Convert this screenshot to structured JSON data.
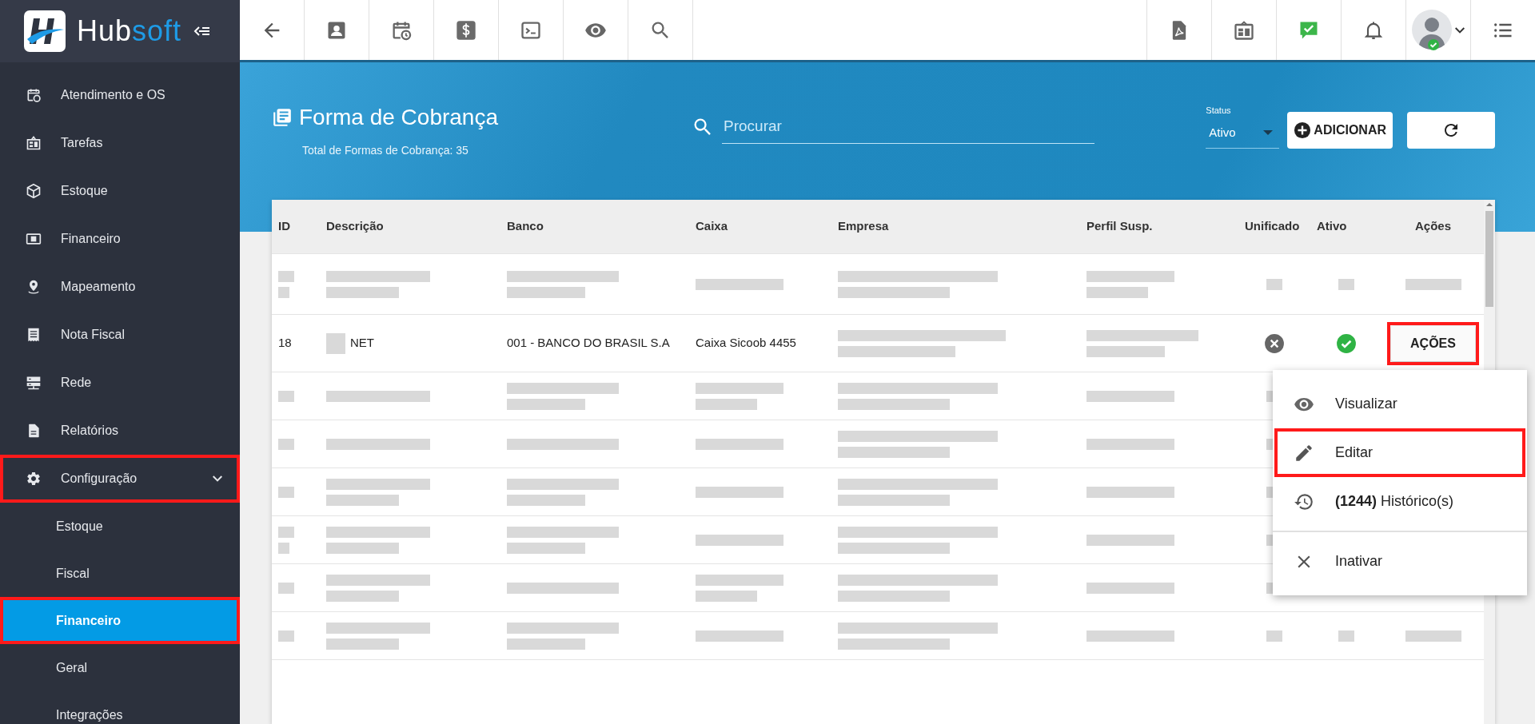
{
  "brand": {
    "main": "Hub",
    "accent": "soft"
  },
  "sidebar": {
    "items": [
      {
        "label": "Atendimento e OS",
        "highlighted": false
      },
      {
        "label": "Tarefas",
        "highlighted": false
      },
      {
        "label": "Estoque",
        "highlighted": false
      },
      {
        "label": "Financeiro",
        "highlighted": false
      },
      {
        "label": "Mapeamento",
        "highlighted": false
      },
      {
        "label": "Nota Fiscal",
        "highlighted": false
      },
      {
        "label": "Rede",
        "highlighted": false
      },
      {
        "label": "Relatórios",
        "highlighted": false
      },
      {
        "label": "Configuração",
        "highlighted": true,
        "expanded": true,
        "children": [
          {
            "label": "Estoque",
            "selected": false,
            "highlighted": false
          },
          {
            "label": "Fiscal",
            "selected": false,
            "highlighted": false
          },
          {
            "label": "Financeiro",
            "selected": true,
            "highlighted": true
          },
          {
            "label": "Geral",
            "selected": false,
            "highlighted": false
          },
          {
            "label": "Integrações",
            "selected": false,
            "highlighted": false
          }
        ]
      }
    ]
  },
  "page_header": {
    "title": "Forma de Cobrança",
    "subtitle": "Total de Formas de Cobrança: 35",
    "search": {
      "placeholder": "Procurar"
    },
    "status": {
      "label": "Status",
      "value": "Ativo"
    },
    "add_button": "ADICIONAR"
  },
  "table": {
    "columns": [
      "ID",
      "Descrição",
      "Banco",
      "Caixa",
      "Empresa",
      "Perfil Susp.",
      "Unificado",
      "Ativo",
      "Ações"
    ],
    "rows": [
      {
        "kind": "blurred"
      },
      {
        "kind": "data",
        "id": "18",
        "description": "NET",
        "description_redacted_prefix": true,
        "bank": "001 - BANCO DO BRASIL S.A",
        "cashier": "Caixa Sicoob 4455",
        "company_redacted": true,
        "suspension_profile_redacted": true,
        "unified": false,
        "active": true,
        "action": "AÇÕES",
        "action_highlighted": true
      },
      {
        "kind": "blurred"
      },
      {
        "kind": "blurred"
      },
      {
        "kind": "blurred"
      },
      {
        "kind": "blurred"
      },
      {
        "kind": "blurred"
      },
      {
        "kind": "blurred"
      }
    ]
  },
  "actions_menu": {
    "groups": [
      [
        {
          "label": "Visualizar",
          "highlighted": false
        },
        {
          "label": "Editar",
          "highlighted": true
        },
        {
          "label": "**(1244)** Histórico(s)",
          "highlighted": false
        }
      ],
      [
        {
          "label": "Inativar",
          "highlighted": false
        }
      ]
    ]
  }
}
